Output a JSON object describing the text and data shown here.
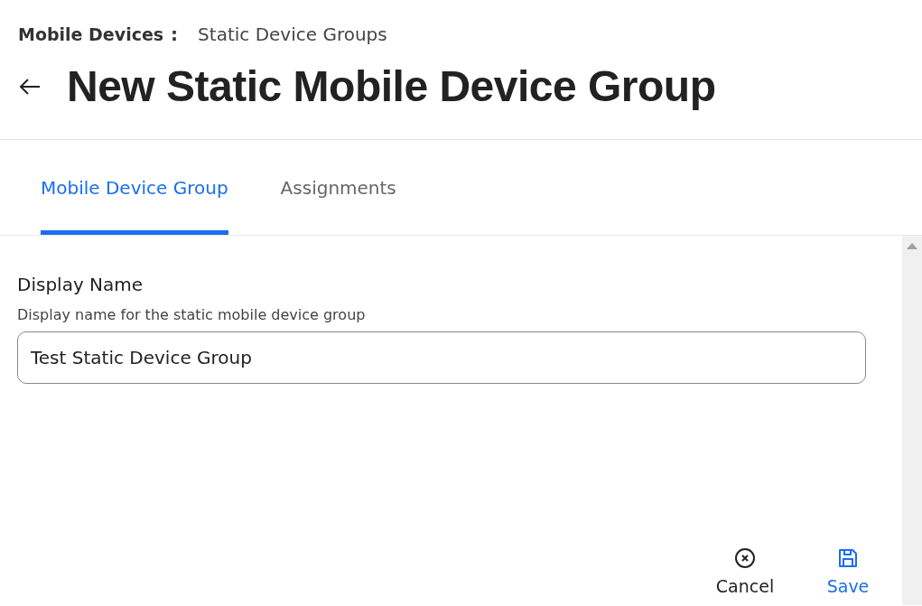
{
  "breadcrumb": {
    "parent": "Mobile Devices",
    "separator": ":",
    "current": "Static Device Groups"
  },
  "title": "New Static Mobile Device Group",
  "tabs": [
    {
      "label": "Mobile Device Group",
      "selected": true
    },
    {
      "label": "Assignments",
      "selected": false
    }
  ],
  "field": {
    "label": "Display Name",
    "description": "Display name for the static mobile device group",
    "value": "Test Static Device Group"
  },
  "actions": [
    {
      "kind": "cancel",
      "label": "Cancel"
    },
    {
      "kind": "save",
      "label": "Save"
    }
  ]
}
